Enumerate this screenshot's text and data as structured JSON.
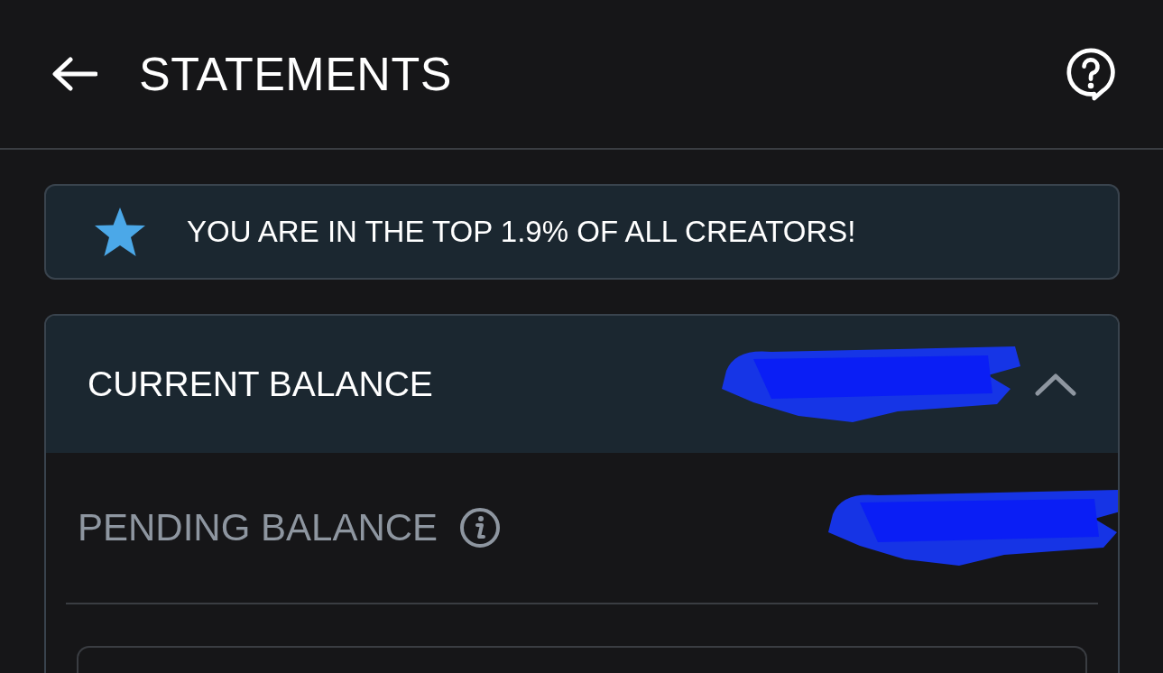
{
  "header": {
    "title": "STATEMENTS"
  },
  "banner": {
    "text": "YOU ARE IN THE TOP 1.9% OF ALL CREATORS!"
  },
  "current_balance": {
    "label": "CURRENT BALANCE",
    "value_redacted": true,
    "expanded": true
  },
  "pending_balance": {
    "label": "PENDING BALANCE",
    "value_redacted": true
  }
}
